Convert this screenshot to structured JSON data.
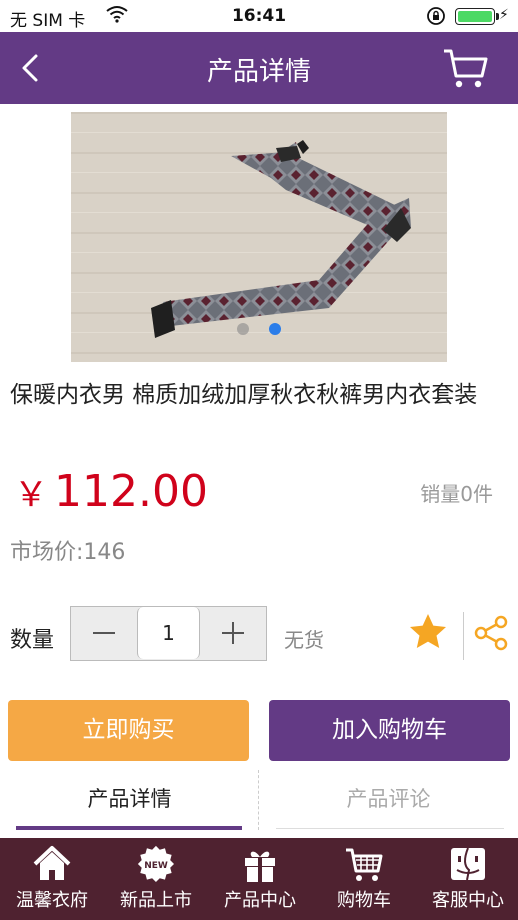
{
  "status_bar": {
    "carrier": "无 SIM 卡",
    "time": "16:41",
    "battery_color": "#4cd964"
  },
  "nav": {
    "title": "产品详情"
  },
  "gallery": {
    "slide_count": 2,
    "active_index": 1
  },
  "product": {
    "title": "保暖内衣男 棉质加绒加厚秋衣秋裤男内衣套装",
    "currency_symbol": "￥",
    "price": "112.00",
    "sales": "销量0件",
    "market_price": "市场价:146"
  },
  "purchase": {
    "qty_label": "数量",
    "quantity": "1",
    "stock_status": "无货"
  },
  "actions": {
    "buy_now": "立即购买",
    "add_to_cart": "加入购物车"
  },
  "tabs": [
    {
      "label": "产品详情",
      "active": true
    },
    {
      "label": "产品评论",
      "active": false
    }
  ],
  "bottom_nav": [
    {
      "label": "温馨衣府",
      "icon": "home-icon"
    },
    {
      "label": "新品上市",
      "icon": "new-badge-icon"
    },
    {
      "label": "产品中心",
      "icon": "gift-icon"
    },
    {
      "label": "购物车",
      "icon": "cart-icon"
    },
    {
      "label": "客服中心",
      "icon": "finder-face-icon"
    }
  ],
  "colors": {
    "brand_purple": "#633a85",
    "price_red": "#d0021b",
    "buy_orange": "#f5a845",
    "bottom_bar": "#4f2230",
    "favorite_orange": "#f5a623"
  }
}
